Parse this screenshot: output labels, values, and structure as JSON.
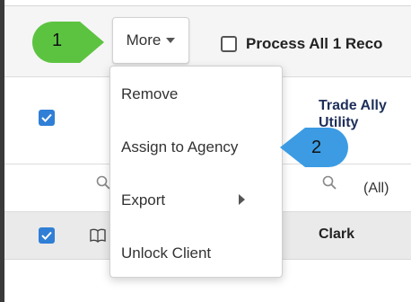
{
  "toolbar": {
    "more_label": "More",
    "process_all_label": "Process All 1 Reco"
  },
  "grid": {
    "column_header": "Trade Ally\nUtility",
    "filter_value": "(All)",
    "row": {
      "name": "Clark"
    }
  },
  "dropdown": {
    "items": [
      "Remove",
      "Assign to Agency",
      "Export",
      "Unlock Client"
    ]
  },
  "callouts": {
    "first": "1",
    "second": "2"
  },
  "colors": {
    "callout_green": "#5cc341",
    "callout_blue": "#3c9be3",
    "checkbox_blue": "#2f7fd6",
    "header_text": "#1e2f5a"
  },
  "icons": [
    "caret-down-icon",
    "checkbox-icon",
    "search-icon",
    "book-icon",
    "chevron-right-icon"
  ]
}
